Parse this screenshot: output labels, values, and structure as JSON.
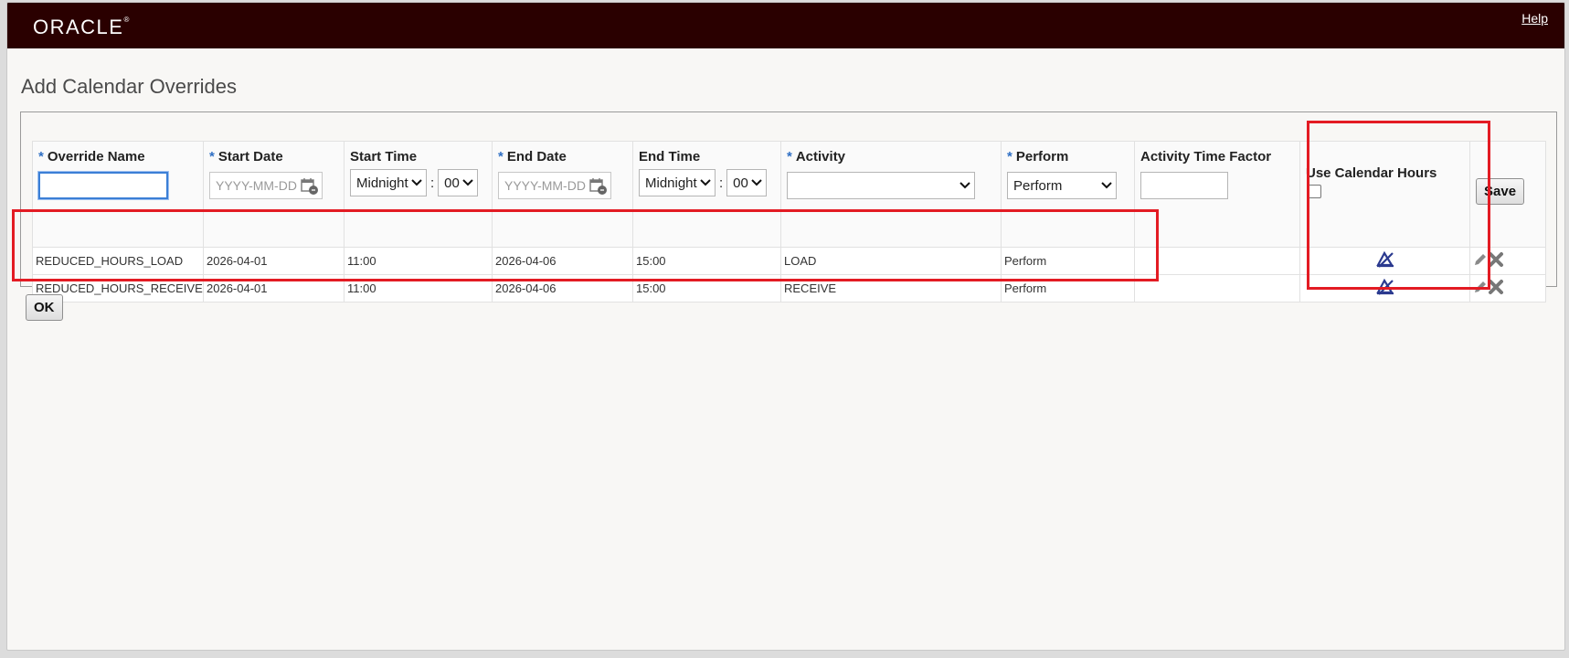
{
  "header": {
    "logo_text": "ORACLE",
    "logo_mark": "®",
    "help_label": "Help",
    "bar_color": "#2a0000"
  },
  "page": {
    "title": "Add Calendar Overrides"
  },
  "columns": {
    "override_name": "Override Name",
    "start_date": "Start Date",
    "start_time": "Start Time",
    "end_date": "End Date",
    "end_time": "End Time",
    "activity": "Activity",
    "perform": "Perform",
    "activity_time_factor": "Activity Time Factor",
    "use_calendar_hours": "Use Calendar Hours",
    "required_marker": "*"
  },
  "form": {
    "override_name_value": "",
    "start_date_placeholder": "YYYY-MM-DD",
    "start_time_hour": "Midnight",
    "start_time_minute": "00",
    "end_date_placeholder": "YYYY-MM-DD",
    "end_time_hour": "Midnight",
    "end_time_minute": "00",
    "activity_value": "",
    "perform_value": "Perform",
    "activity_time_factor_value": "",
    "use_calendar_hours_checked": false,
    "save_label": "Save",
    "time_separator": ":"
  },
  "rows": [
    {
      "override_name": "REDUCED_HOURS_LOAD",
      "start_date": "2026-04-01",
      "start_time": "11:00",
      "end_date": "2026-04-06",
      "end_time": "15:00",
      "activity": "LOAD",
      "perform": "Perform",
      "activity_time_factor": "",
      "use_calendar_hours_icon": "unchecked-icon"
    },
    {
      "override_name": "REDUCED_HOURS_RECEIVE",
      "start_date": "2026-04-01",
      "start_time": "11:00",
      "end_date": "2026-04-06",
      "end_time": "15:00",
      "activity": "RECEIVE",
      "perform": "Perform",
      "activity_time_factor": "",
      "use_calendar_hours_icon": "unchecked-icon"
    }
  ],
  "footer": {
    "ok_label": "OK"
  },
  "colors": {
    "required": "#2f6fc4",
    "highlight": "#e31b23",
    "icon_blue": "#2b3a8f"
  }
}
